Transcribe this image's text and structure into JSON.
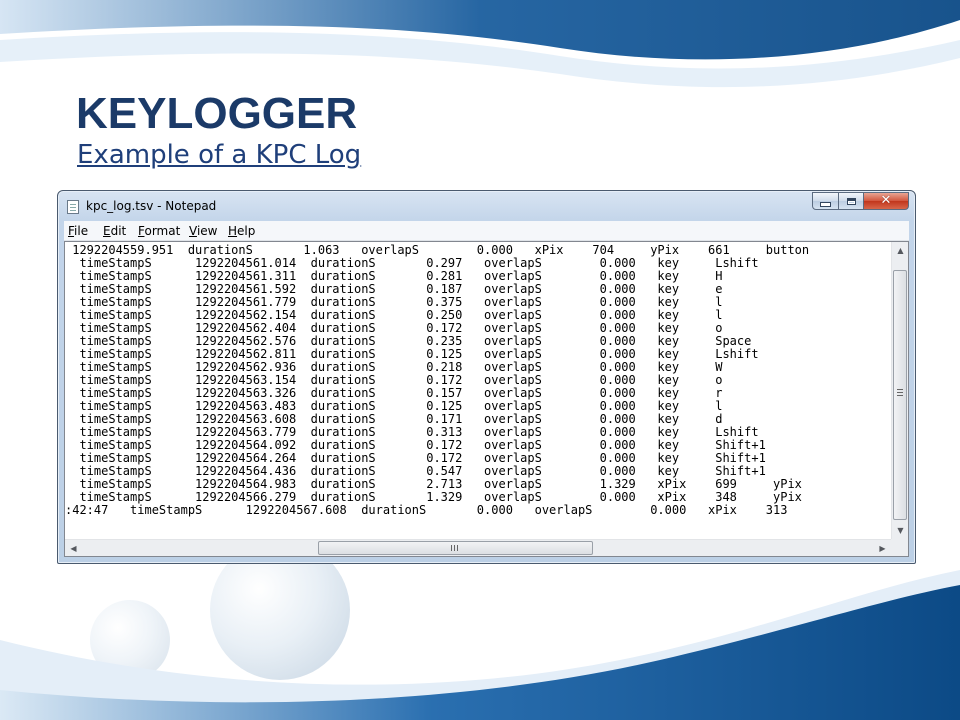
{
  "slide": {
    "title": "KEYLOGGER",
    "subtitle": "Example of a KPC Log"
  },
  "window": {
    "title": "kpc_log.tsv - Notepad",
    "close_symbol": "✕"
  },
  "menu": {
    "items": [
      "File",
      "Edit",
      "Format",
      "View",
      "Help"
    ]
  },
  "log": {
    "lines": [
      " 1292204559.951  durationS       1.063   overlapS        0.000   xPix    704     yPix    661     button",
      "  timeStampS      1292204561.014  durationS       0.297   overlapS        0.000   key     Lshift",
      "  timeStampS      1292204561.311  durationS       0.281   overlapS        0.000   key     H",
      "  timeStampS      1292204561.592  durationS       0.187   overlapS        0.000   key     e",
      "  timeStampS      1292204561.779  durationS       0.375   overlapS        0.000   key     l",
      "  timeStampS      1292204562.154  durationS       0.250   overlapS        0.000   key     l",
      "  timeStampS      1292204562.404  durationS       0.172   overlapS        0.000   key     o",
      "  timeStampS      1292204562.576  durationS       0.235   overlapS        0.000   key     Space",
      "  timeStampS      1292204562.811  durationS       0.125   overlapS        0.000   key     Lshift",
      "  timeStampS      1292204562.936  durationS       0.218   overlapS        0.000   key     W",
      "  timeStampS      1292204563.154  durationS       0.172   overlapS        0.000   key     o",
      "  timeStampS      1292204563.326  durationS       0.157   overlapS        0.000   key     r",
      "  timeStampS      1292204563.483  durationS       0.125   overlapS        0.000   key     l",
      "  timeStampS      1292204563.608  durationS       0.171   overlapS        0.000   key     d",
      "  timeStampS      1292204563.779  durationS       0.313   overlapS        0.000   key     Lshift",
      "  timeStampS      1292204564.092  durationS       0.172   overlapS        0.000   key     Shift+1",
      "  timeStampS      1292204564.264  durationS       0.172   overlapS        0.000   key     Shift+1",
      "  timeStampS      1292204564.436  durationS       0.547   overlapS        0.000   key     Shift+1",
      "  timeStampS      1292204564.983  durationS       2.713   overlapS        1.329   xPix    699     yPix",
      "  timeStampS      1292204566.279  durationS       1.329   overlapS        0.000   xPix    348     yPix",
      ":42:47   timeStampS      1292204567.608  durationS       0.000   overlapS        0.000   xPix    313"
    ]
  },
  "scrollbar": {
    "up_arrow": "▲",
    "down_arrow": "▼",
    "left_arrow": "◀",
    "right_arrow": "▶",
    "grip": "≡",
    "grip_h": "|||"
  },
  "colors": {
    "title": "#1b3a68",
    "subtitle": "#1f3f7a",
    "wave_dark": "#0d4d8c",
    "wave_light": "#cfe2f3"
  }
}
